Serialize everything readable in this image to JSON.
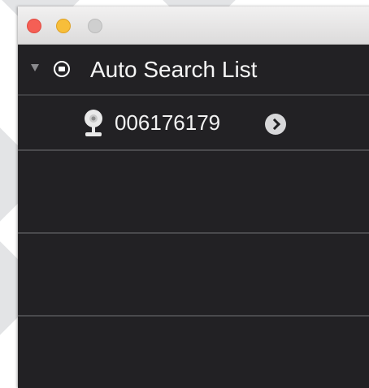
{
  "window": {
    "controls": {
      "close": "close-button",
      "minimize": "minimize-button",
      "zoom": "zoom-button"
    }
  },
  "list": {
    "group": {
      "label": "Auto Search List",
      "icon": "folder-circle-icon",
      "expanded": true
    },
    "devices": [
      {
        "label": "006176179",
        "icon": "camera-icon",
        "accessory": "chevron-right-circle-icon"
      }
    ]
  },
  "colors": {
    "list_background": "#222124",
    "separator": "#4a4a4d",
    "text": "#f5f5f5",
    "close": "#f55f55",
    "minimize": "#f7be3a",
    "zoom_disabled": "#cfcfcf"
  }
}
